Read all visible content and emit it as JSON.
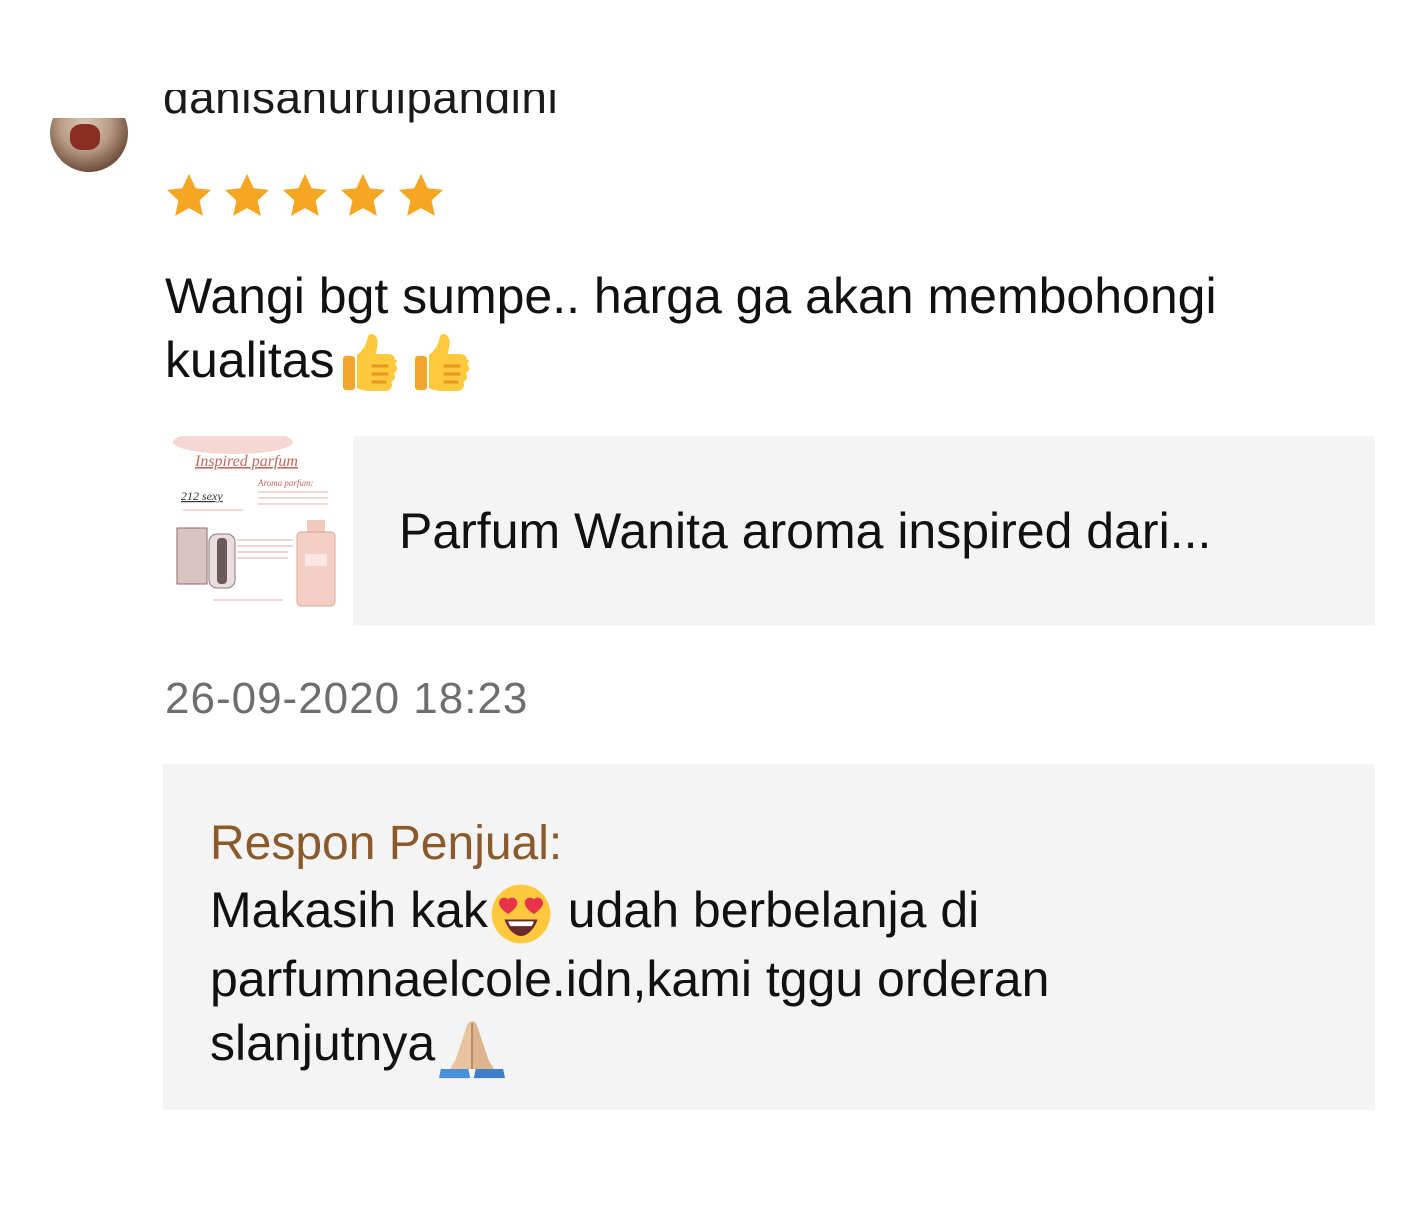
{
  "review": {
    "username": "danisanurulpandini",
    "rating": 5,
    "star_color": "#F5A623",
    "comment_text": "Wangi bgt sumpe.. harga ga akan membohongi kualitas",
    "comment_emojis": [
      "thumbs-up",
      "thumbs-up"
    ],
    "product": {
      "thumbnail_title": "Inspired parfum",
      "thumbnail_subtitle": "Aroma parfum:",
      "thumbnail_label": "212 sexy",
      "name": "Parfum Wanita aroma inspired dari..."
    },
    "timestamp": "26-09-2020 18:23",
    "seller_response": {
      "label": "Respon Penjual:",
      "text_part1": "Makasih kak",
      "text_part2": " udah berbelanja di parfumnaelcole.idn,kami tggu orderan slanjutnya",
      "emojis": [
        "heart-eyes",
        "folded-hands"
      ],
      "label_color": "#8A5A2B"
    }
  }
}
